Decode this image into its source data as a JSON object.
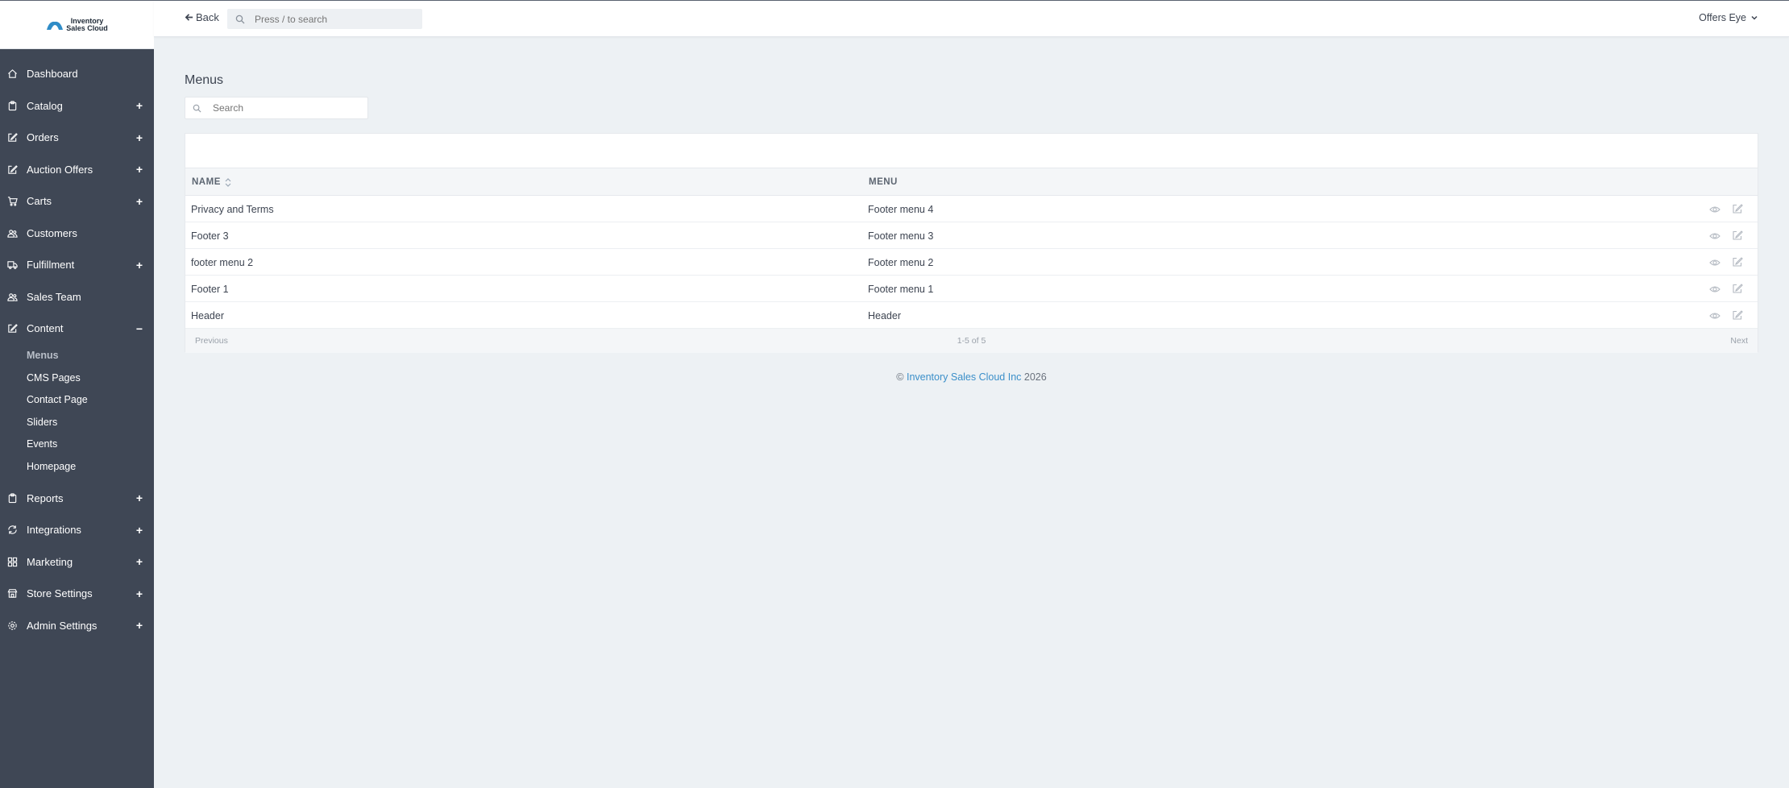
{
  "brand": {
    "logo_line1": "Inventory",
    "logo_line2": "Sales Cloud"
  },
  "header": {
    "back_label": "Back",
    "search_placeholder": "Press / to search",
    "user_name": "Offers Eye"
  },
  "sidebar": {
    "items": [
      {
        "label": "Dashboard",
        "icon": "home-icon",
        "toggle": ""
      },
      {
        "label": "Catalog",
        "icon": "clipboard-icon",
        "toggle": "+"
      },
      {
        "label": "Orders",
        "icon": "edit-icon",
        "toggle": "+"
      },
      {
        "label": "Auction Offers",
        "icon": "edit-icon",
        "toggle": "+"
      },
      {
        "label": "Carts",
        "icon": "cart-icon",
        "toggle": "+"
      },
      {
        "label": "Customers",
        "icon": "users-icon",
        "toggle": ""
      },
      {
        "label": "Fulfillment",
        "icon": "truck-icon",
        "toggle": "+"
      },
      {
        "label": "Sales Team",
        "icon": "users-icon",
        "toggle": ""
      },
      {
        "label": "Content",
        "icon": "edit-icon",
        "toggle": "−"
      },
      {
        "label": "Reports",
        "icon": "clipboard-icon",
        "toggle": "+"
      },
      {
        "label": "Integrations",
        "icon": "sync-icon",
        "toggle": "+"
      },
      {
        "label": "Marketing",
        "icon": "grid-icon",
        "toggle": "+"
      },
      {
        "label": "Store Settings",
        "icon": "store-icon",
        "toggle": "+"
      },
      {
        "label": "Admin Settings",
        "icon": "gear-icon",
        "toggle": "+"
      }
    ],
    "content_subitems": [
      "Menus",
      "CMS Pages",
      "Contact Page",
      "Sliders",
      "Events",
      "Homepage"
    ]
  },
  "main": {
    "title": "Menus",
    "search_placeholder": "Search",
    "columns": {
      "name": "NAME",
      "menu": "MENU"
    },
    "rows": [
      {
        "name": "Privacy and Terms",
        "menu": "Footer menu 4"
      },
      {
        "name": "Footer 3",
        "menu": "Footer menu 3"
      },
      {
        "name": "footer menu 2",
        "menu": "Footer menu 2"
      },
      {
        "name": "Footer 1",
        "menu": "Footer menu 1"
      },
      {
        "name": "Header",
        "menu": "Header"
      }
    ],
    "pagination": {
      "previous": "Previous",
      "count": "1-5 of 5",
      "next": "Next"
    }
  },
  "footer": {
    "prefix": "©",
    "company": "Inventory Sales Cloud Inc",
    "year": "2026"
  },
  "colors": {
    "sidebar_bg": "#3f4755",
    "page_bg": "#edf1f4",
    "link": "#3b8fc9"
  }
}
